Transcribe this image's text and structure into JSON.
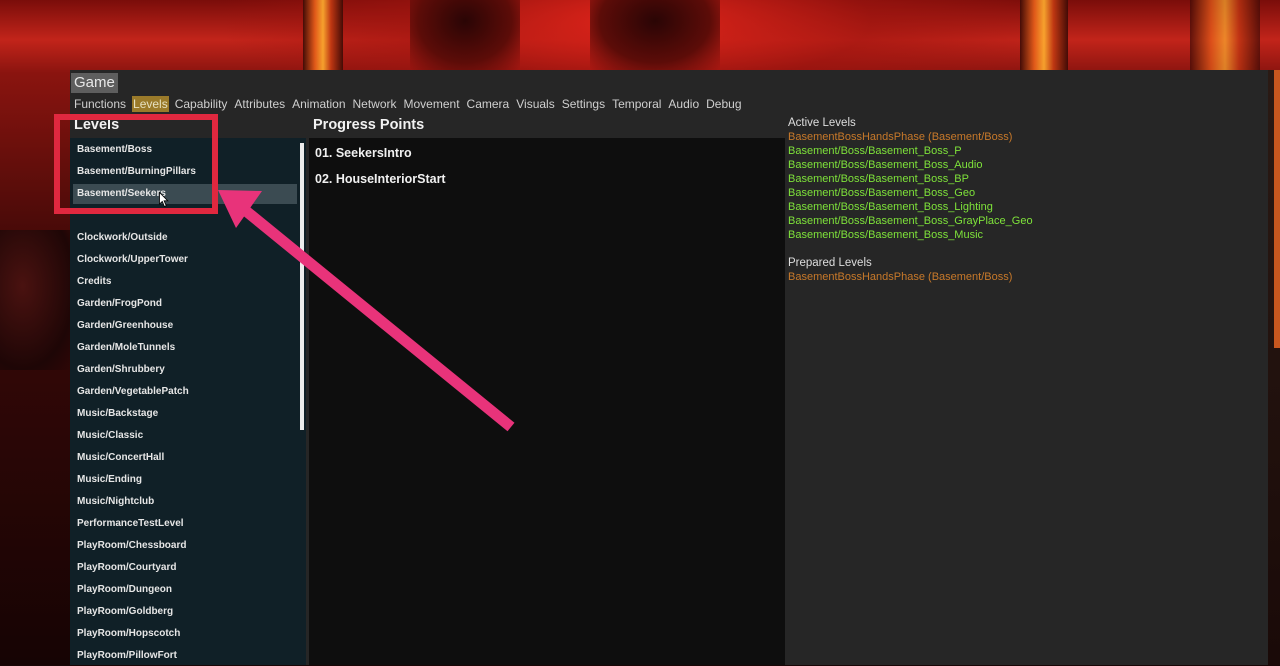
{
  "window": {
    "title": "Game"
  },
  "tabs": [
    {
      "label": "Functions",
      "active": false
    },
    {
      "label": "Levels",
      "active": true
    },
    {
      "label": "Capability",
      "active": false
    },
    {
      "label": "Attributes",
      "active": false
    },
    {
      "label": "Animation",
      "active": false
    },
    {
      "label": "Network",
      "active": false
    },
    {
      "label": "Movement",
      "active": false
    },
    {
      "label": "Camera",
      "active": false
    },
    {
      "label": "Visuals",
      "active": false
    },
    {
      "label": "Settings",
      "active": false
    },
    {
      "label": "Temporal",
      "active": false
    },
    {
      "label": "Audio",
      "active": false
    },
    {
      "label": "Debug",
      "active": false
    }
  ],
  "levels": {
    "header": "Levels",
    "selected": "Basement/Seekers",
    "items": [
      "Basement/Boss",
      "Basement/BurningPillars",
      "Basement/Seekers",
      "",
      "Clockwork/Outside",
      "Clockwork/UpperTower",
      "Credits",
      "Garden/FrogPond",
      "Garden/Greenhouse",
      "Garden/MoleTunnels",
      "Garden/Shrubbery",
      "Garden/VegetablePatch",
      "Music/Backstage",
      "Music/Classic",
      "Music/ConcertHall",
      "Music/Ending",
      "Music/Nightclub",
      "PerformanceTestLevel",
      "PlayRoom/Chessboard",
      "PlayRoom/Courtyard",
      "PlayRoom/Dungeon",
      "PlayRoom/Goldberg",
      "PlayRoom/Hopscotch",
      "PlayRoom/PillowFort"
    ]
  },
  "progress": {
    "header": "Progress Points",
    "items": [
      "01. SeekersIntro",
      "02. HouseInteriorStart"
    ]
  },
  "active_levels": {
    "label": "Active Levels",
    "phase": "BasementBossHandsPhase (Basement/Boss)",
    "items": [
      "Basement/Boss/Basement_Boss_P",
      "Basement/Boss/Basement_Boss_Audio",
      "Basement/Boss/Basement_Boss_BP",
      "Basement/Boss/Basement_Boss_Geo",
      "Basement/Boss/Basement_Boss_Lighting",
      "Basement/Boss/Basement_Boss_GrayPlace_Geo",
      "Basement/Boss/Basement_Boss_Music"
    ]
  },
  "prepared_levels": {
    "label": "Prepared Levels",
    "items": [
      "BasementBossHandsPhase (Basement/Boss)"
    ]
  },
  "colors": {
    "accent_tab": "#9a7a2a",
    "active_level_text": "#7ee23a",
    "phase_text": "#c8792a",
    "annotation": "#e0283f",
    "arrow": "#e8337a"
  }
}
